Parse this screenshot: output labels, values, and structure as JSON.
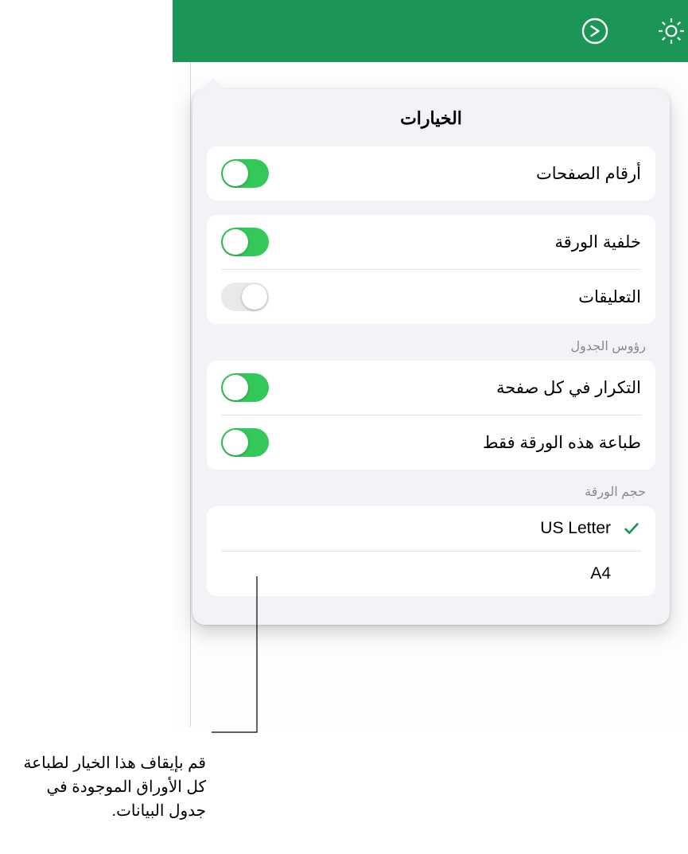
{
  "popover": {
    "title": "الخيارات",
    "group1": {
      "page_numbers": {
        "label": "أرقام الصفحات",
        "on": true
      }
    },
    "group2": {
      "sheet_bg": {
        "label": "خلفية الورقة",
        "on": true
      },
      "comments": {
        "label": "التعليقات",
        "on": false
      }
    },
    "headers_section": "رؤوس الجدول",
    "group3": {
      "repeat": {
        "label": "التكرار في كل صفحة",
        "on": true
      },
      "this_only": {
        "label": "طباعة هذه الورقة فقط",
        "on": true
      }
    },
    "paper_section": "حجم الورقة",
    "paper": {
      "us_letter": {
        "label": "US Letter",
        "selected": true
      },
      "a4": {
        "label": "A4",
        "selected": false
      }
    }
  },
  "callout": "قم بإيقاف هذا الخيار لطباعة كل الأوراق الموجودة في جدول البيانات."
}
